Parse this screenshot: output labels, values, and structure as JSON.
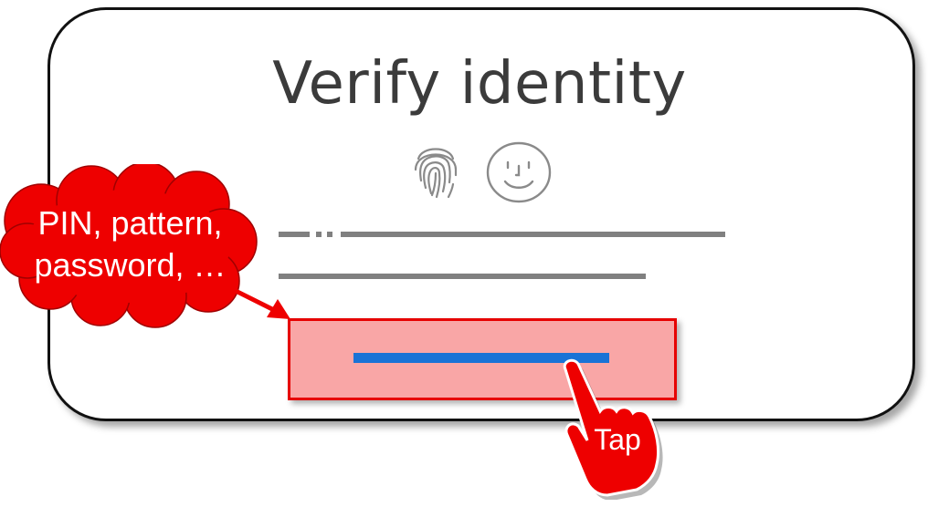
{
  "dialog": {
    "title": "Verify identity",
    "icons": [
      "fingerprint-icon",
      "face-icon"
    ]
  },
  "annotations": {
    "cloud_label": "PIN, pattern, password, …",
    "tap_label": "Tap"
  },
  "colors": {
    "highlight_fill": "#f9a6a6",
    "highlight_border": "#e60000",
    "primary_button": "#1a73d6",
    "placeholder_text": "#808080",
    "title_text": "#3b3b3b"
  }
}
